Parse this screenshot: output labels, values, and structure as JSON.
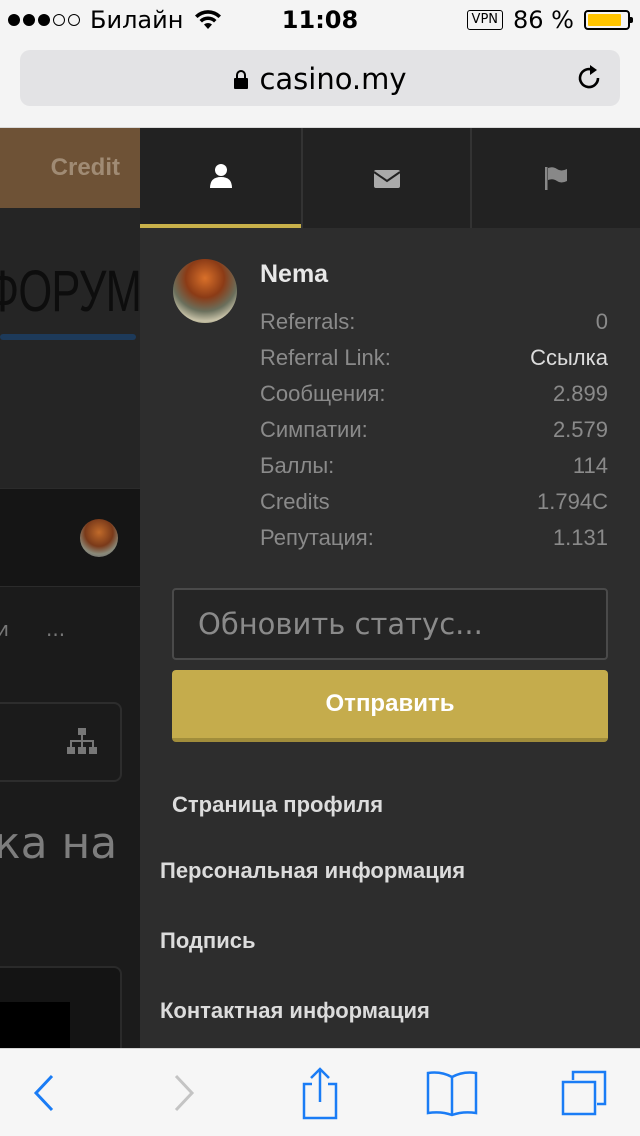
{
  "status_bar": {
    "carrier": "Билайн",
    "time": "11:08",
    "vpn": "VPN",
    "battery": "86 %",
    "battery_level": 0.86,
    "signal_bars_filled": 3,
    "signal_bars_total": 5
  },
  "browser": {
    "url": "casino.my"
  },
  "background_page": {
    "credit_tab": "Credit",
    "banner_text": "ФОРУМ",
    "nav_partial": "и",
    "nav_more": "...",
    "heading_partial": "ка на"
  },
  "panel": {
    "tabs": [
      {
        "icon": "user-icon"
      },
      {
        "icon": "envelope-icon"
      },
      {
        "icon": "flag-icon"
      }
    ],
    "username": "Nema",
    "stats": [
      {
        "label": "Referrals:",
        "value": "0"
      },
      {
        "label": "Referral Link:",
        "value": "Ссылка"
      },
      {
        "label": "Сообщения:",
        "value": "2.899"
      },
      {
        "label": "Симпатии:",
        "value": "2.579"
      },
      {
        "label": "Баллы:",
        "value": "114"
      },
      {
        "label": "Credits",
        "value": "1.794C"
      },
      {
        "label": "Репутация:",
        "value": "1.131"
      }
    ],
    "status_placeholder": "Обновить статус...",
    "submit_label": "Отправить",
    "menu": {
      "profile_page": "Страница профиля",
      "personal_info": "Персональная информация",
      "signature": "Подпись",
      "contact_info": "Контактная информация"
    },
    "accent_color": "#c5ac4c"
  },
  "toolbar": {
    "buttons": [
      "back",
      "forward",
      "share",
      "bookmarks",
      "tabs"
    ],
    "accent_color": "#1a7cf5"
  }
}
